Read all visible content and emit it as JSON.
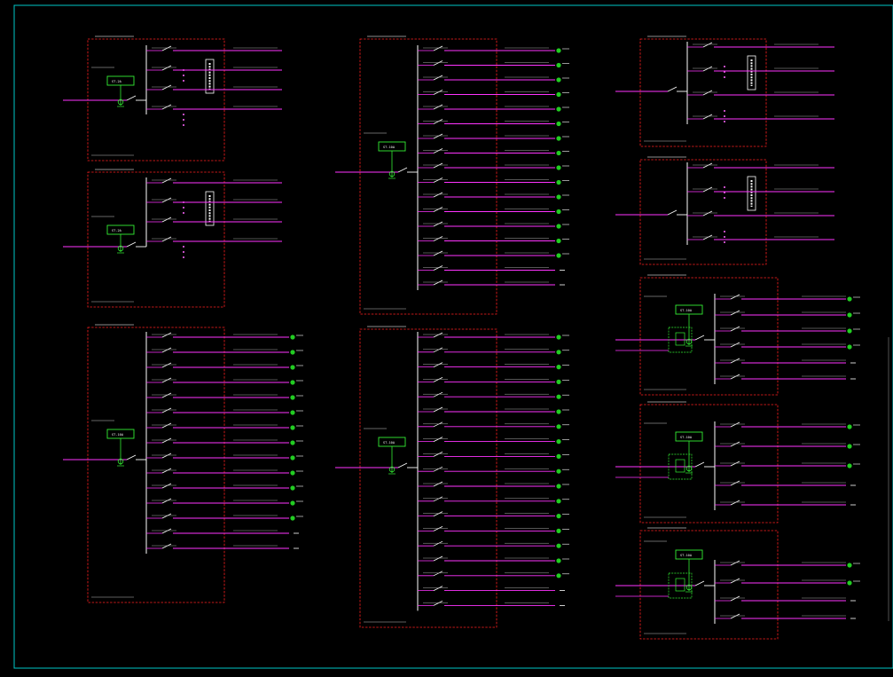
{
  "drawing": {
    "colors": {
      "background": "#000000",
      "border": "#00c8c8",
      "panel_outline": "#ff2020",
      "busbar": "#ffffff",
      "feeder": "#ff33ff",
      "breaker_block": "#33ee33",
      "load_dot": "#22cc22",
      "label": "#ffffff"
    }
  },
  "panels": [
    {
      "id": "L1-1",
      "breaker_label": "ST-2A",
      "feeders": 4,
      "type": "distribution_small",
      "loads": false
    },
    {
      "id": "L1-2",
      "breaker_label": "ST-2A",
      "feeders": 4,
      "type": "distribution_small",
      "loads": false
    },
    {
      "id": "L1-3",
      "breaker_label": "ST-10A",
      "feeders": 15,
      "type": "lighting",
      "loads": true
    },
    {
      "id": "M1-1",
      "breaker_label": "ST-10A",
      "feeders": 17,
      "type": "lighting",
      "loads": true
    },
    {
      "id": "M1-2",
      "breaker_label": "ST-10A",
      "feeders": 19,
      "type": "lighting",
      "loads": true
    },
    {
      "id": "R1-1",
      "breaker_label": "",
      "feeders": 4,
      "type": "distribution_small",
      "loads": false
    },
    {
      "id": "R1-2",
      "breaker_label": "",
      "feeders": 4,
      "type": "distribution_small",
      "loads": false
    },
    {
      "id": "R2-1",
      "breaker_label": "ST-10A",
      "feeders": 6,
      "type": "power",
      "loads": true
    },
    {
      "id": "R2-2",
      "breaker_label": "ST-10A",
      "feeders": 5,
      "type": "power",
      "loads": true
    },
    {
      "id": "R2-3",
      "breaker_label": "ST-10A",
      "feeders": 4,
      "type": "power",
      "loads": true
    }
  ]
}
